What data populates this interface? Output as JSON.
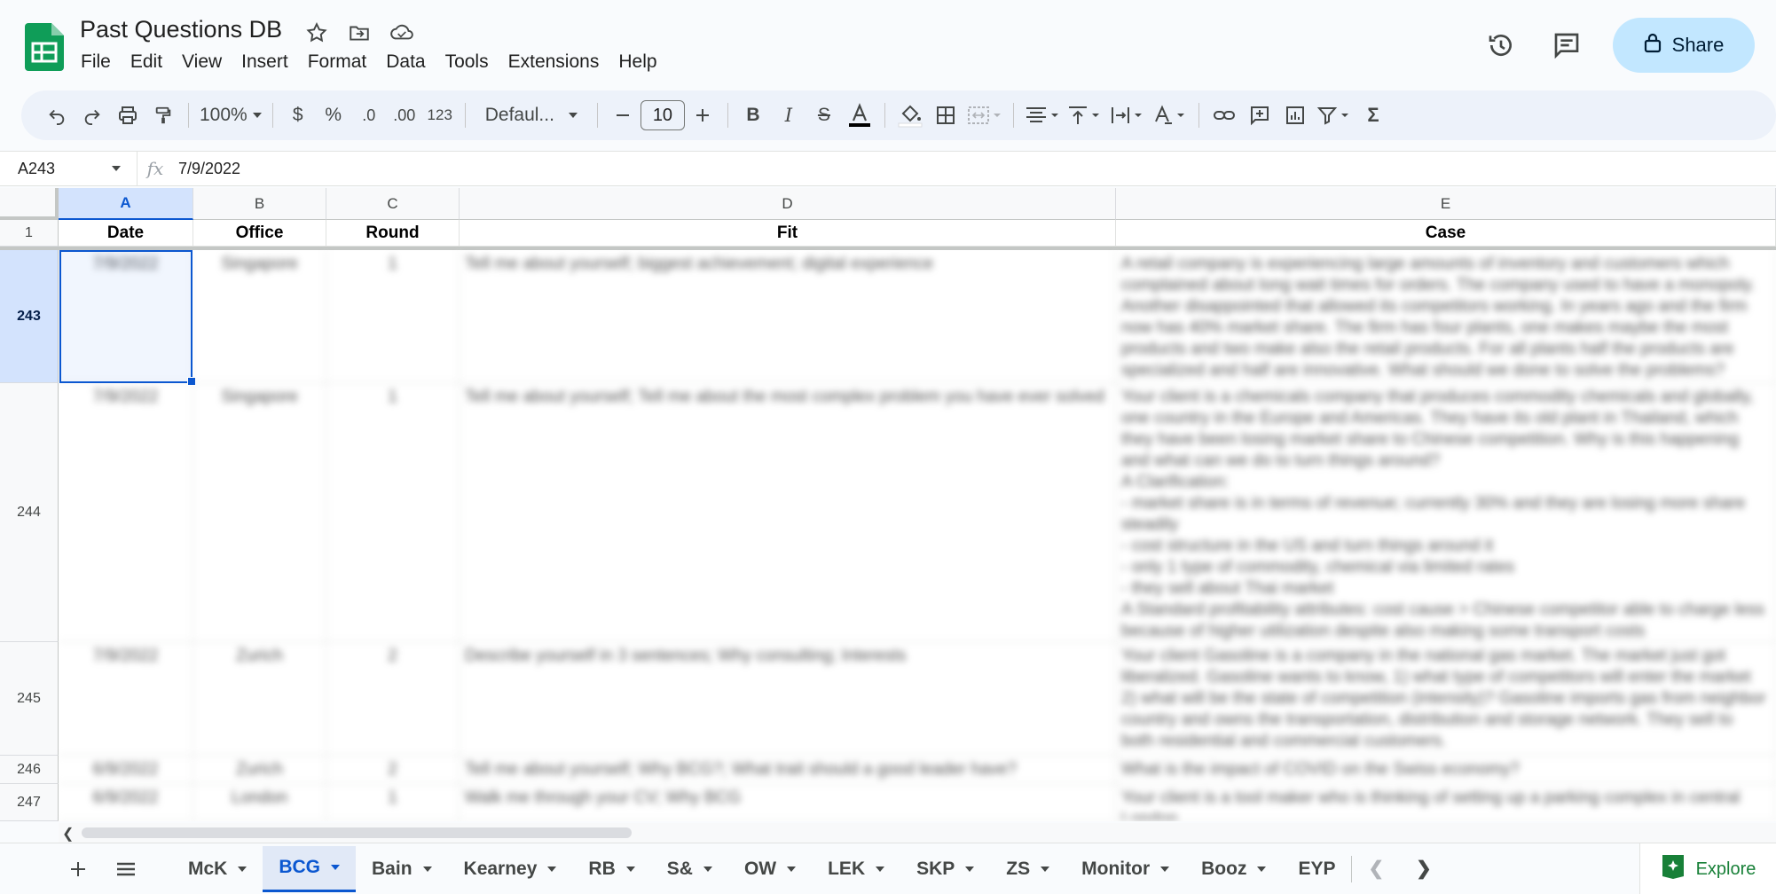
{
  "doc": {
    "title": "Past Questions DB"
  },
  "menu": [
    "File",
    "Edit",
    "View",
    "Insert",
    "Format",
    "Data",
    "Tools",
    "Extensions",
    "Help"
  ],
  "header": {
    "share_label": "Share"
  },
  "toolbar": {
    "zoom": "100%",
    "currency": "$",
    "percent": "%",
    "dec_dec": ".0",
    "dec_inc": ".00",
    "number_format": "123",
    "font": "Defaul...",
    "font_size": "10"
  },
  "formula": {
    "cell_ref": "A243",
    "value": "7/9/2022"
  },
  "columns": [
    "A",
    "B",
    "C",
    "D",
    "E"
  ],
  "header_row": {
    "num": "1",
    "cells": [
      "Date",
      "Office",
      "Round",
      "Fit",
      "Case"
    ]
  },
  "rows": [
    {
      "num": "243",
      "date": "7/9/2022",
      "office": "Singapore",
      "round": "1",
      "fit": "Tell me about yourself; biggest achievement; digital experience",
      "case": "A retail company is experiencing large amounts of inventory and customers which complained about long wait times for orders. The company used to have a monopoly. Another disappointed that allowed its competitors working. In years ago and the firm now has 40% market share. The firm has four plants, one makes maybe the most products and two make also the retail products. For all plants half the products are specialized and half are innovative. What should we done to solve the problems?"
    },
    {
      "num": "244",
      "date": "7/9/2022",
      "office": "Singapore",
      "round": "1",
      "fit": "Tell me about yourself; Tell me about the most complex problem you have ever solved",
      "case": "Your client is a chemicals company that produces commodity chemicals and globally, one country in the Europe and Americas. They have its old plant in Thailand, which they have been losing market share to Chinese competition. Why is this happening and what can we do to turn things around?\nA Clarification:\n- market share is in terms of revenue; currently 30% and they are losing more share steadily\n- cost structure in the US and turn things around it\n- only 1 type of commodity, chemical via limited rates\n- they sell about Thai market\nA Standard profitability attributes: cost cause > Chinese competitor able to charge less because of higher utilization despite also making some transport costs"
    },
    {
      "num": "245",
      "date": "7/9/2022",
      "office": "Zurich",
      "round": "2",
      "fit": "Describe yourself in 3 sentences; Why consulting; Interests",
      "case": "Your client Gasoline is a company in the national gas market. The market just got liberalized. Gasoline wants to know, 1) what type of competitors will enter the market 2) what will be the state of competition (intensity)? Gasoline imports gas from neighbor country and owns the transportation, distribution and storage network. They sell to both residential and commercial customers."
    },
    {
      "num": "246",
      "date": "6/9/2022",
      "office": "Zurich",
      "round": "2",
      "fit": "Tell me about yourself; Why BCG?; What trait should a good leader have?",
      "case": "What is the impact of COVID on the Swiss economy?"
    },
    {
      "num": "247",
      "date": "6/9/2022",
      "office": "London",
      "round": "1",
      "fit": "Walk me through your CV; Why BCG",
      "case": "Your client is a tool maker who is thinking of setting up a parking complex in central London."
    }
  ],
  "tabs": [
    "McK",
    "BCG",
    "Bain",
    "Kearney",
    "RB",
    "S&",
    "OW",
    "LEK",
    "SKP",
    "ZS",
    "Monitor",
    "Booz",
    "EYP"
  ],
  "active_tab": "BCG",
  "explore_label": "Explore",
  "colors": {
    "accent": "#0b57d0",
    "share_bg": "#c2e7ff",
    "sheets_green": "#0f9d58"
  }
}
